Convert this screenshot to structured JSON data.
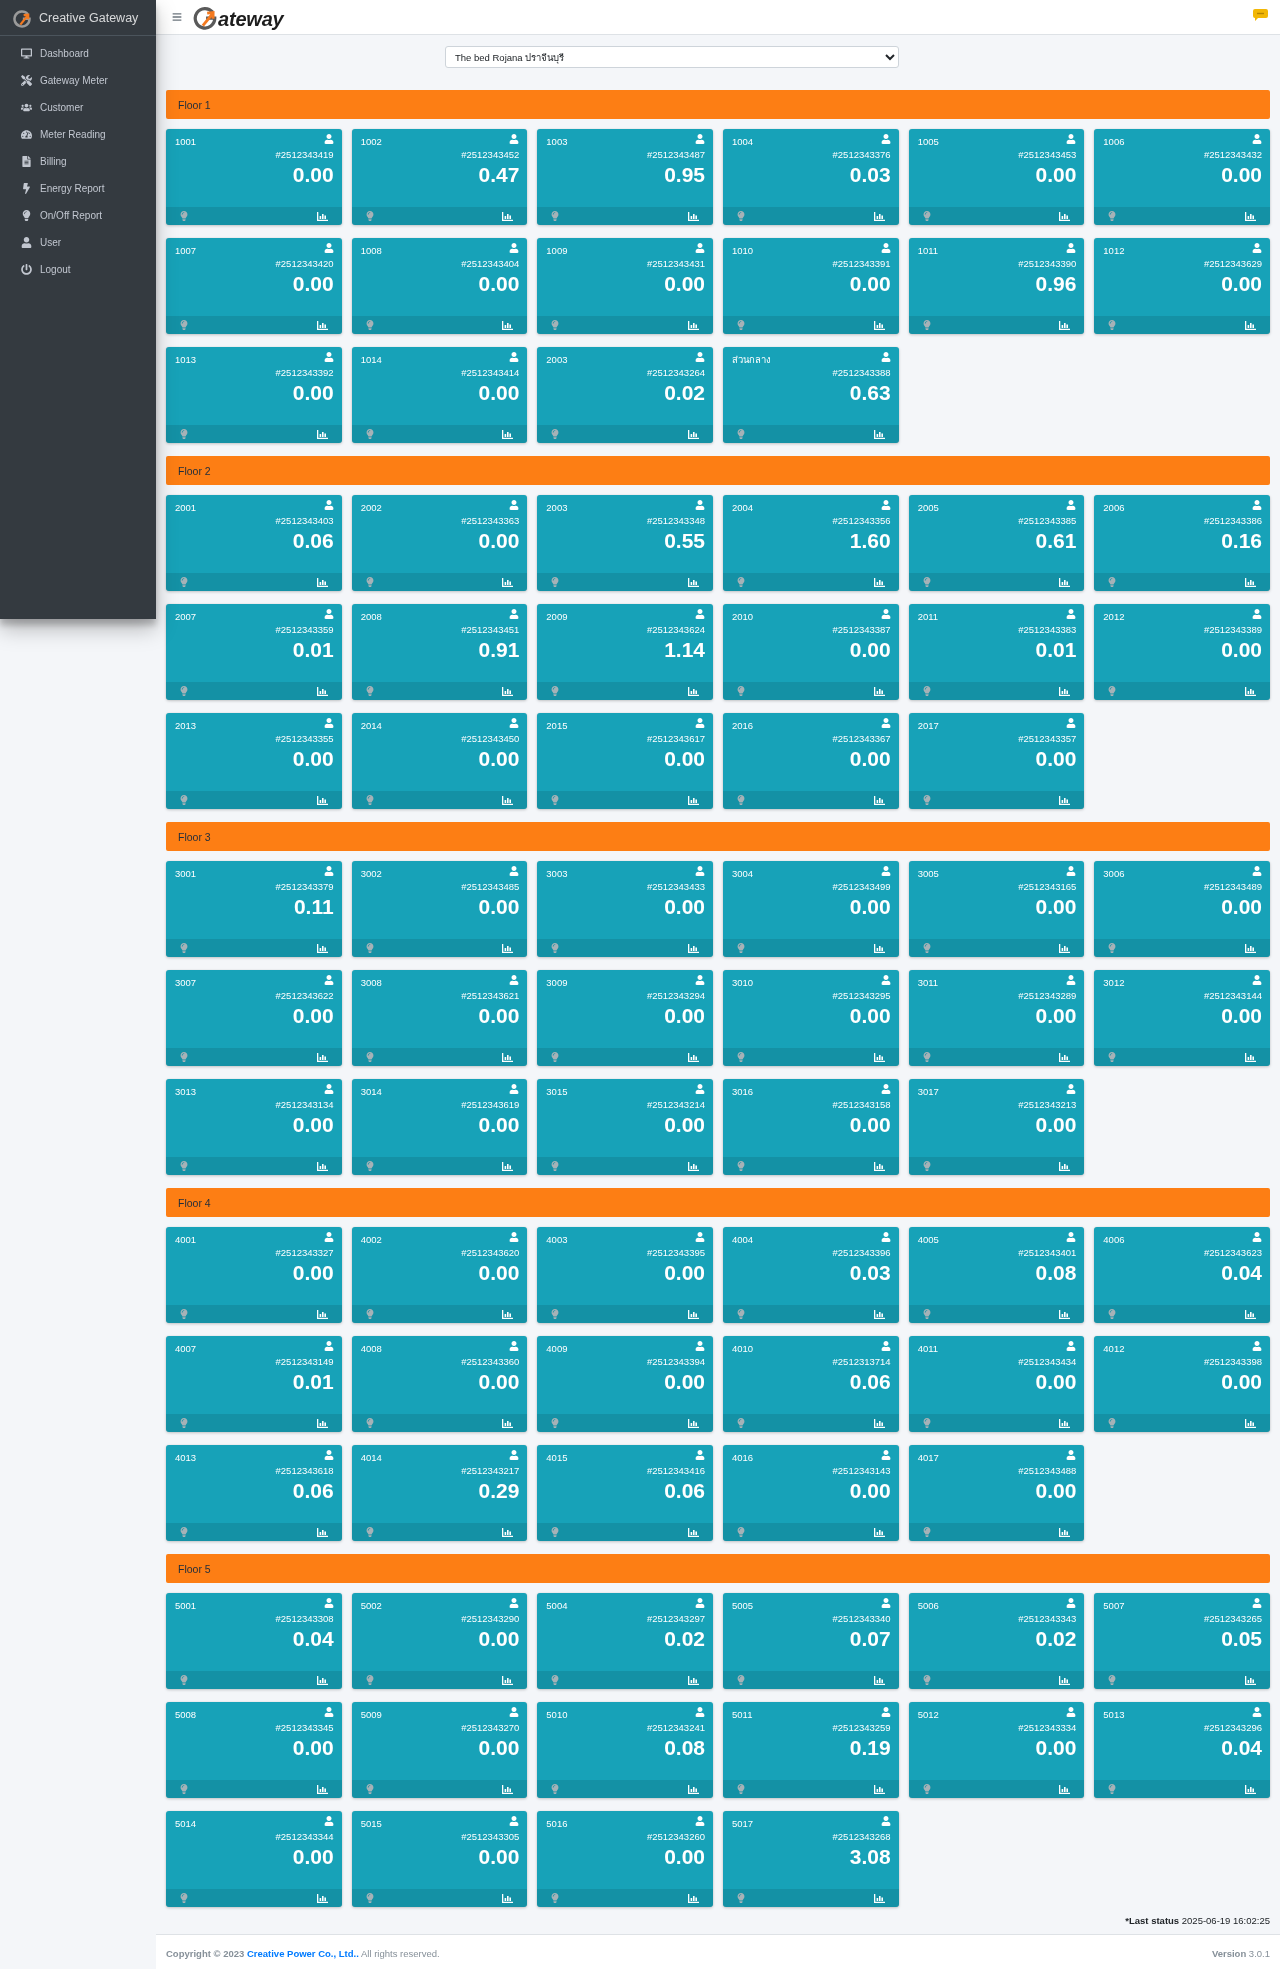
{
  "sidebar": {
    "brand": "Creative Gateway",
    "items": [
      {
        "label": "Dashboard",
        "selected": false
      },
      {
        "label": "Gateway Meter",
        "selected": false
      },
      {
        "label": "Customer",
        "selected": false
      },
      {
        "label": "Meter Reading",
        "selected": false
      },
      {
        "label": "Billing",
        "selected": false
      },
      {
        "label": "Energy Report",
        "selected": false
      },
      {
        "label": "On/Off Report",
        "selected": false
      },
      {
        "label": "User",
        "selected": false
      },
      {
        "label": "Logout",
        "selected": false
      }
    ]
  },
  "header": {
    "logo_text": "ateway"
  },
  "site_select": {
    "value": "The bed Rojana ปราจีนบุรี"
  },
  "floors": [
    {
      "title": "Floor 1",
      "meters": [
        {
          "unit": "1001",
          "meter_id": "#2512343419",
          "reading": "0.00",
          "lamp_on": false
        },
        {
          "unit": "1002",
          "meter_id": "#2512343452",
          "reading": "0.47",
          "lamp_on": false
        },
        {
          "unit": "1003",
          "meter_id": "#2512343487",
          "reading": "0.95",
          "lamp_on": false
        },
        {
          "unit": "1004",
          "meter_id": "#2512343376",
          "reading": "0.03",
          "lamp_on": false
        },
        {
          "unit": "1005",
          "meter_id": "#2512343453",
          "reading": "0.00",
          "lamp_on": false
        },
        {
          "unit": "1006",
          "meter_id": "#2512343432",
          "reading": "0.00",
          "lamp_on": false
        },
        {
          "unit": "1007",
          "meter_id": "#2512343420",
          "reading": "0.00",
          "lamp_on": false
        },
        {
          "unit": "1008",
          "meter_id": "#2512343404",
          "reading": "0.00",
          "lamp_on": false
        },
        {
          "unit": "1009",
          "meter_id": "#2512343431",
          "reading": "0.00",
          "lamp_on": false
        },
        {
          "unit": "1010",
          "meter_id": "#2512343391",
          "reading": "0.00",
          "lamp_on": false
        },
        {
          "unit": "1011",
          "meter_id": "#2512343390",
          "reading": "0.96",
          "lamp_on": false
        },
        {
          "unit": "1012",
          "meter_id": "#2512343629",
          "reading": "0.00",
          "lamp_on": false
        },
        {
          "unit": "1013",
          "meter_id": "#2512343392",
          "reading": "0.00",
          "lamp_on": false
        },
        {
          "unit": "1014",
          "meter_id": "#2512343414",
          "reading": "0.00",
          "lamp_on": false
        },
        {
          "unit": "2003",
          "meter_id": "#2512343264",
          "reading": "0.02",
          "lamp_on": false
        },
        {
          "unit": "ส่วนกลาง",
          "meter_id": "#2512343388",
          "reading": "0.63",
          "lamp_on": false
        }
      ]
    },
    {
      "title": "Floor 2",
      "meters": [
        {
          "unit": "2001",
          "meter_id": "#2512343403",
          "reading": "0.06",
          "lamp_on": false
        },
        {
          "unit": "2002",
          "meter_id": "#2512343363",
          "reading": "0.00",
          "lamp_on": false
        },
        {
          "unit": "2003",
          "meter_id": "#2512343348",
          "reading": "0.55",
          "lamp_on": false
        },
        {
          "unit": "2004",
          "meter_id": "#2512343356",
          "reading": "1.60",
          "lamp_on": false
        },
        {
          "unit": "2005",
          "meter_id": "#2512343385",
          "reading": "0.61",
          "lamp_on": false
        },
        {
          "unit": "2006",
          "meter_id": "#2512343386",
          "reading": "0.16",
          "lamp_on": false
        },
        {
          "unit": "2007",
          "meter_id": "#2512343359",
          "reading": "0.01",
          "lamp_on": false
        },
        {
          "unit": "2008",
          "meter_id": "#2512343451",
          "reading": "0.91",
          "lamp_on": false
        },
        {
          "unit": "2009",
          "meter_id": "#2512343624",
          "reading": "1.14",
          "lamp_on": false
        },
        {
          "unit": "2010",
          "meter_id": "#2512343387",
          "reading": "0.00",
          "lamp_on": false
        },
        {
          "unit": "2011",
          "meter_id": "#2512343383",
          "reading": "0.01",
          "lamp_on": false
        },
        {
          "unit": "2012",
          "meter_id": "#2512343389",
          "reading": "0.00",
          "lamp_on": false
        },
        {
          "unit": "2013",
          "meter_id": "#2512343355",
          "reading": "0.00",
          "lamp_on": false
        },
        {
          "unit": "2014",
          "meter_id": "#2512343450",
          "reading": "0.00",
          "lamp_on": false
        },
        {
          "unit": "2015",
          "meter_id": "#2512343617",
          "reading": "0.00",
          "lamp_on": false
        },
        {
          "unit": "2016",
          "meter_id": "#2512343367",
          "reading": "0.00",
          "lamp_on": false
        },
        {
          "unit": "2017",
          "meter_id": "#2512343357",
          "reading": "0.00",
          "lamp_on": false
        }
      ]
    },
    {
      "title": "Floor 3",
      "meters": [
        {
          "unit": "3001",
          "meter_id": "#2512343379",
          "reading": "0.11",
          "lamp_on": false
        },
        {
          "unit": "3002",
          "meter_id": "#2512343485",
          "reading": "0.00",
          "lamp_on": false
        },
        {
          "unit": "3003",
          "meter_id": "#2512343433",
          "reading": "0.00",
          "lamp_on": false
        },
        {
          "unit": "3004",
          "meter_id": "#2512343499",
          "reading": "0.00",
          "lamp_on": false
        },
        {
          "unit": "3005",
          "meter_id": "#2512343165",
          "reading": "0.00",
          "lamp_on": false
        },
        {
          "unit": "3006",
          "meter_id": "#2512343489",
          "reading": "0.00",
          "lamp_on": false
        },
        {
          "unit": "3007",
          "meter_id": "#2512343622",
          "reading": "0.00",
          "lamp_on": false
        },
        {
          "unit": "3008",
          "meter_id": "#2512343621",
          "reading": "0.00",
          "lamp_on": false
        },
        {
          "unit": "3009",
          "meter_id": "#2512343294",
          "reading": "0.00",
          "lamp_on": false
        },
        {
          "unit": "3010",
          "meter_id": "#2512343295",
          "reading": "0.00",
          "lamp_on": false
        },
        {
          "unit": "3011",
          "meter_id": "#2512343289",
          "reading": "0.00",
          "lamp_on": false
        },
        {
          "unit": "3012",
          "meter_id": "#2512343144",
          "reading": "0.00",
          "lamp_on": false
        },
        {
          "unit": "3013",
          "meter_id": "#2512343134",
          "reading": "0.00",
          "lamp_on": false
        },
        {
          "unit": "3014",
          "meter_id": "#2512343619",
          "reading": "0.00",
          "lamp_on": false
        },
        {
          "unit": "3015",
          "meter_id": "#2512343214",
          "reading": "0.00",
          "lamp_on": false
        },
        {
          "unit": "3016",
          "meter_id": "#2512343158",
          "reading": "0.00",
          "lamp_on": false
        },
        {
          "unit": "3017",
          "meter_id": "#2512343213",
          "reading": "0.00",
          "lamp_on": false
        }
      ]
    },
    {
      "title": "Floor 4",
      "meters": [
        {
          "unit": "4001",
          "meter_id": "#2512343327",
          "reading": "0.00",
          "lamp_on": false
        },
        {
          "unit": "4002",
          "meter_id": "#2512343620",
          "reading": "0.00",
          "lamp_on": false
        },
        {
          "unit": "4003",
          "meter_id": "#2512343395",
          "reading": "0.00",
          "lamp_on": false
        },
        {
          "unit": "4004",
          "meter_id": "#2512343396",
          "reading": "0.03",
          "lamp_on": false
        },
        {
          "unit": "4005",
          "meter_id": "#2512343401",
          "reading": "0.08",
          "lamp_on": false
        },
        {
          "unit": "4006",
          "meter_id": "#2512343623",
          "reading": "0.04",
          "lamp_on": false
        },
        {
          "unit": "4007",
          "meter_id": "#2512343149",
          "reading": "0.01",
          "lamp_on": false
        },
        {
          "unit": "4008",
          "meter_id": "#2512343360",
          "reading": "0.00",
          "lamp_on": false
        },
        {
          "unit": "4009",
          "meter_id": "#2512343394",
          "reading": "0.00",
          "lamp_on": false
        },
        {
          "unit": "4010",
          "meter_id": "#2512313714",
          "reading": "0.06",
          "lamp_on": false
        },
        {
          "unit": "4011",
          "meter_id": "#2512343434",
          "reading": "0.00",
          "lamp_on": false
        },
        {
          "unit": "4012",
          "meter_id": "#2512343398",
          "reading": "0.00",
          "lamp_on": false
        },
        {
          "unit": "4013",
          "meter_id": "#2512343618",
          "reading": "0.06",
          "lamp_on": false
        },
        {
          "unit": "4014",
          "meter_id": "#2512343217",
          "reading": "0.29",
          "lamp_on": false
        },
        {
          "unit": "4015",
          "meter_id": "#2512343416",
          "reading": "0.06",
          "lamp_on": false
        },
        {
          "unit": "4016",
          "meter_id": "#2512343143",
          "reading": "0.00",
          "lamp_on": false
        },
        {
          "unit": "4017",
          "meter_id": "#2512343488",
          "reading": "0.00",
          "lamp_on": false
        }
      ]
    },
    {
      "title": "Floor 5",
      "meters": [
        {
          "unit": "5001",
          "meter_id": "#2512343308",
          "reading": "0.04",
          "lamp_on": false
        },
        {
          "unit": "5002",
          "meter_id": "#2512343290",
          "reading": "0.00",
          "lamp_on": false
        },
        {
          "unit": "5004",
          "meter_id": "#2512343297",
          "reading": "0.02",
          "lamp_on": false
        },
        {
          "unit": "5005",
          "meter_id": "#2512343340",
          "reading": "0.07",
          "lamp_on": false
        },
        {
          "unit": "5006",
          "meter_id": "#2512343343",
          "reading": "0.02",
          "lamp_on": false
        },
        {
          "unit": "5007",
          "meter_id": "#2512343265",
          "reading": "0.05",
          "lamp_on": false
        },
        {
          "unit": "5008",
          "meter_id": "#2512343345",
          "reading": "0.00",
          "lamp_on": false
        },
        {
          "unit": "5009",
          "meter_id": "#2512343270",
          "reading": "0.00",
          "lamp_on": false
        },
        {
          "unit": "5010",
          "meter_id": "#2512343241",
          "reading": "0.08",
          "lamp_on": false
        },
        {
          "unit": "5011",
          "meter_id": "#2512343259",
          "reading": "0.19",
          "lamp_on": false
        },
        {
          "unit": "5012",
          "meter_id": "#2512343334",
          "reading": "0.00",
          "lamp_on": false
        },
        {
          "unit": "5013",
          "meter_id": "#2512343296",
          "reading": "0.04",
          "lamp_on": false
        },
        {
          "unit": "5014",
          "meter_id": "#2512343344",
          "reading": "0.00",
          "lamp_on": false
        },
        {
          "unit": "5015",
          "meter_id": "#2512343305",
          "reading": "0.00",
          "lamp_on": false
        },
        {
          "unit": "5016",
          "meter_id": "#2512343260",
          "reading": "0.00",
          "lamp_on": false
        },
        {
          "unit": "5017",
          "meter_id": "#2512343268",
          "reading": "3.08",
          "lamp_on": false
        }
      ]
    }
  ],
  "last_status": {
    "label": "*Last status",
    "value": "2025-06-19 16:02:25"
  },
  "footer": {
    "copyright": "Copyright © 2023",
    "company_link": "Creative Power Co., Ltd..",
    "rights": "All rights reserved.",
    "version_label": "Version",
    "version": "3.0.1"
  }
}
